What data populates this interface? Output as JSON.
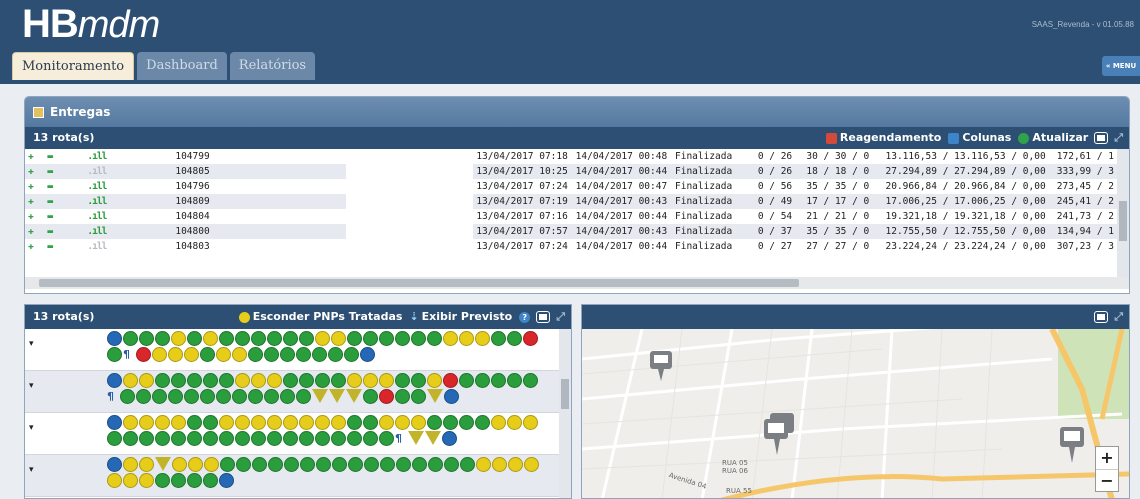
{
  "app": {
    "logo": "HB",
    "logo_suffix": "mdm",
    "version": "SAAS_Revenda - v 01.05.88"
  },
  "tabs": [
    {
      "label": "Monitoramento",
      "active": true
    },
    {
      "label": "Dashboard",
      "active": false
    },
    {
      "label": "Relatórios",
      "active": false
    }
  ],
  "menu_label": "« MENU",
  "entregas": {
    "title": "Entregas",
    "count_label": "13 rota(s)",
    "actions": {
      "reagendamento": "Reagendamento",
      "colunas": "Colunas",
      "atualizar": "Atualizar"
    },
    "rows": [
      {
        "signal": "strong",
        "id": "104799",
        "start": "13/04/2017 07:18",
        "end": "14/04/2017 00:48",
        "status": "Finalizada",
        "progress": "0 / 26",
        "counts": "30 / 30 / 0",
        "values": "13.116,53 / 13.116,53 / 0,00",
        "extra": "172,61 / 1"
      },
      {
        "signal": "weak",
        "id": "104805",
        "start": "13/04/2017 10:25",
        "end": "14/04/2017 00:44",
        "status": "Finalizada",
        "progress": "0 / 26",
        "counts": "18 / 18 / 0",
        "values": "27.294,89 / 27.294,89 / 0,00",
        "extra": "333,99 / 3"
      },
      {
        "signal": "strong",
        "id": "104796",
        "start": "13/04/2017 07:24",
        "end": "14/04/2017 00:47",
        "status": "Finalizada",
        "progress": "0 / 56",
        "counts": "35 / 35 / 0",
        "values": "20.966,84 / 20.966,84 / 0,00",
        "extra": "273,45 / 2"
      },
      {
        "signal": "strong",
        "id": "104809",
        "start": "13/04/2017 07:19",
        "end": "14/04/2017 00:43",
        "status": "Finalizada",
        "progress": "0 / 49",
        "counts": "17 / 17 / 0",
        "values": "17.006,25 / 17.006,25 / 0,00",
        "extra": "245,41 / 2"
      },
      {
        "signal": "strong",
        "id": "104804",
        "start": "13/04/2017 07:16",
        "end": "14/04/2017 00:44",
        "status": "Finalizada",
        "progress": "0 / 54",
        "counts": "21 / 21 / 0",
        "values": "19.321,18 / 19.321,18 / 0,00",
        "extra": "241,73 / 2"
      },
      {
        "signal": "strong",
        "id": "104800",
        "start": "13/04/2017 07:57",
        "end": "14/04/2017 00:43",
        "status": "Finalizada",
        "progress": "0 / 37",
        "counts": "35 / 35 / 0",
        "values": "12.755,50 / 12.755,50 / 0,00",
        "extra": "134,94 / 1"
      },
      {
        "signal": "weak",
        "id": "104803",
        "start": "13/04/2017 07:24",
        "end": "14/04/2017 00:44",
        "status": "Finalizada",
        "progress": "0 / 27",
        "counts": "27 / 27 / 0",
        "values": "23.224,24 / 23.224,24 / 0,00",
        "extra": "307,23 / 3"
      }
    ]
  },
  "pnp": {
    "count_label": "13 rota(s)",
    "esconder_label": "Esconder PNPs Tratadas",
    "exibir_label": "Exibir Previsto",
    "rows": [
      "bgggygyggggggyyggggggyyyggrg|kryyygyygggggggb",
      "byygggggyyyggggyyyggyrgggggkgg|ggggggggggtttgrggtb",
      "byyyyggyyyyyyyyggyyygggg|yyyggggggggggggggggggkttb",
      "byytyyyggggggggggggggggyyyyy|yyggggb"
    ]
  },
  "map": {
    "streets": [
      "RUA 05",
      "RUA 06",
      "RUA 55",
      "Avenida 04"
    ],
    "zoom_in": "+",
    "zoom_out": "−"
  },
  "colors": {
    "header_bg": "#2d4f73",
    "panel_head": "#6e8eb1",
    "green": "#2a9d3c",
    "yellow": "#e6cd1a",
    "blue": "#2568b6",
    "red": "#d8262a"
  }
}
